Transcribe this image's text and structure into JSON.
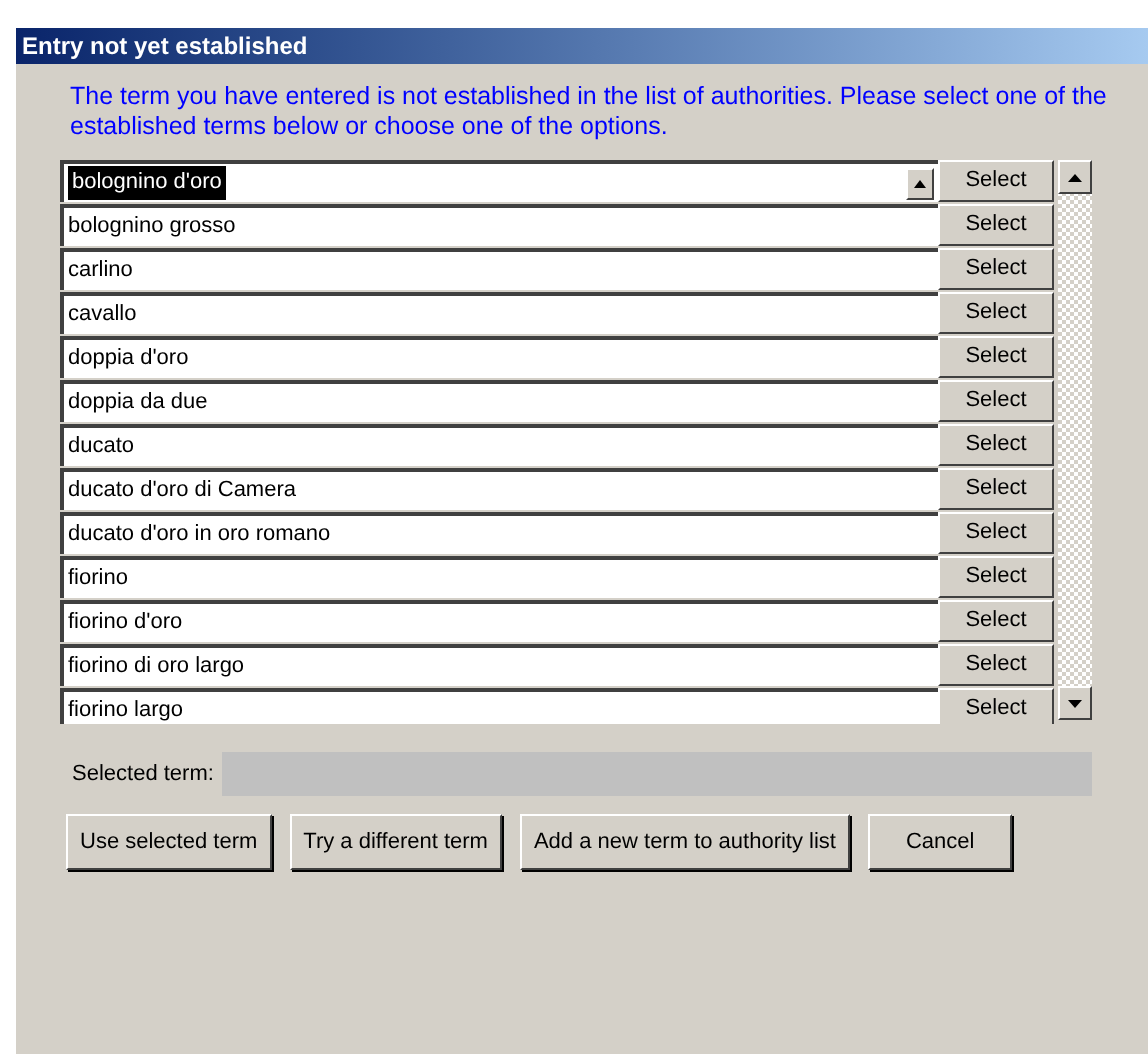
{
  "window": {
    "title": "Entry not yet established"
  },
  "message": "The term you have entered is not established in the list of authorities. Please select one of the established terms below or choose one of the options.",
  "terms": [
    {
      "label": "bolognino d'oro",
      "selected": true,
      "button": "Select"
    },
    {
      "label": "bolognino grosso",
      "selected": false,
      "button": "Select"
    },
    {
      "label": "carlino",
      "selected": false,
      "button": "Select"
    },
    {
      "label": "cavallo",
      "selected": false,
      "button": "Select"
    },
    {
      "label": "doppia d'oro",
      "selected": false,
      "button": "Select"
    },
    {
      "label": "doppia da due",
      "selected": false,
      "button": "Select"
    },
    {
      "label": "ducato",
      "selected": false,
      "button": "Select"
    },
    {
      "label": "ducato d'oro di Camera",
      "selected": false,
      "button": "Select"
    },
    {
      "label": "ducato d'oro in oro romano",
      "selected": false,
      "button": "Select"
    },
    {
      "label": "fiorino",
      "selected": false,
      "button": "Select"
    },
    {
      "label": "fiorino d'oro",
      "selected": false,
      "button": "Select"
    },
    {
      "label": "fiorino di oro largo",
      "selected": false,
      "button": "Select"
    },
    {
      "label": "fiorino largo",
      "selected": false,
      "button": "Select"
    }
  ],
  "selected_term": {
    "label": "Selected term:"
  },
  "buttons": [
    "Use selected term",
    "Try a different term",
    "Add a new term to authority list",
    "Cancel"
  ]
}
